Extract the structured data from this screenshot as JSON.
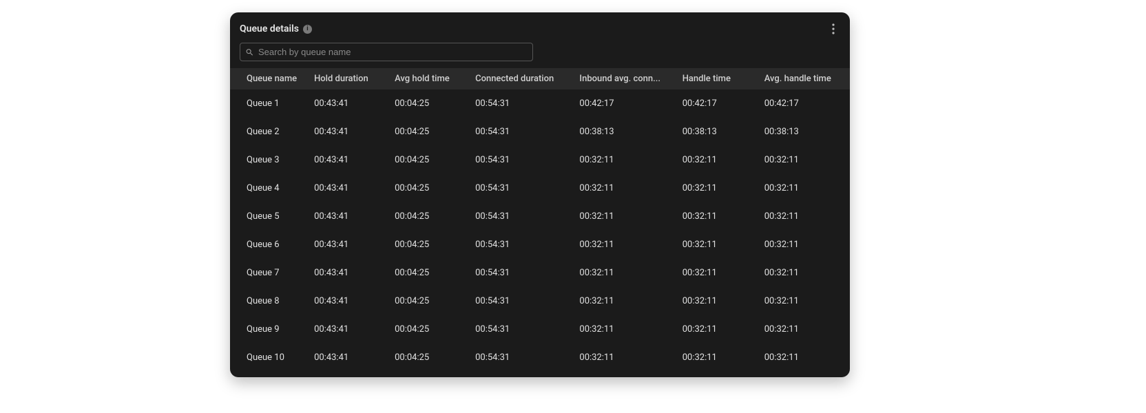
{
  "header": {
    "title": "Queue details",
    "info_glyph": "i"
  },
  "search": {
    "placeholder": "Search by queue name",
    "value": ""
  },
  "table": {
    "columns": [
      "Queue name",
      "Hold duration",
      "Avg hold time",
      "Connected duration",
      "Inbound avg. conn...",
      "Handle time",
      "Avg. handle time"
    ],
    "rows": [
      {
        "cells": [
          "Queue 1",
          "00:43:41",
          "00:04:25",
          "00:54:31",
          "00:42:17",
          "00:42:17",
          "00:42:17"
        ]
      },
      {
        "cells": [
          "Queue 2",
          "00:43:41",
          "00:04:25",
          "00:54:31",
          "00:38:13",
          "00:38:13",
          "00:38:13"
        ]
      },
      {
        "cells": [
          "Queue 3",
          "00:43:41",
          "00:04:25",
          "00:54:31",
          "00:32:11",
          "00:32:11",
          "00:32:11"
        ]
      },
      {
        "cells": [
          "Queue 4",
          "00:43:41",
          "00:04:25",
          "00:54:31",
          "00:32:11",
          "00:32:11",
          "00:32:11"
        ]
      },
      {
        "cells": [
          "Queue 5",
          "00:43:41",
          "00:04:25",
          "00:54:31",
          "00:32:11",
          "00:32:11",
          "00:32:11"
        ]
      },
      {
        "cells": [
          "Queue 6",
          "00:43:41",
          "00:04:25",
          "00:54:31",
          "00:32:11",
          "00:32:11",
          "00:32:11"
        ]
      },
      {
        "cells": [
          "Queue 7",
          "00:43:41",
          "00:04:25",
          "00:54:31",
          "00:32:11",
          "00:32:11",
          "00:32:11"
        ]
      },
      {
        "cells": [
          "Queue 8",
          "00:43:41",
          "00:04:25",
          "00:54:31",
          "00:32:11",
          "00:32:11",
          "00:32:11"
        ]
      },
      {
        "cells": [
          "Queue 9",
          "00:43:41",
          "00:04:25",
          "00:54:31",
          "00:32:11",
          "00:32:11",
          "00:32:11"
        ]
      },
      {
        "cells": [
          "Queue 10",
          "00:43:41",
          "00:04:25",
          "00:54:31",
          "00:32:11",
          "00:32:11",
          "00:32:11"
        ]
      }
    ]
  }
}
